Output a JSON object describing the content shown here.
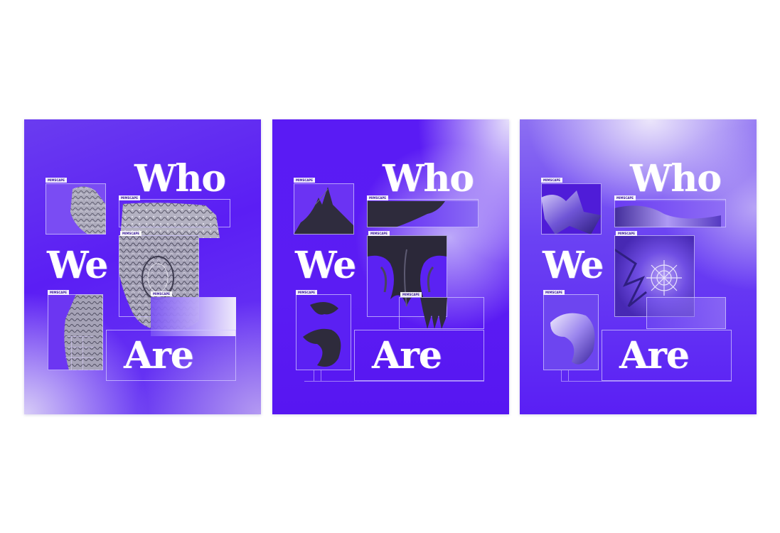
{
  "posters": [
    {
      "words": {
        "line1": "Who",
        "line2": "We",
        "line3": "Are"
      },
      "tags": [
        "MIMSCAPE",
        "MIMSCAPE",
        "MIMSCAPE",
        "MIMSCAPE",
        "MIMSCAPE"
      ]
    },
    {
      "words": {
        "line1": "Who",
        "line2": "We",
        "line3": "Are"
      },
      "tags": [
        "MIMSCAPE",
        "MIMSCAPE",
        "MIMSCAPE",
        "MIMSCAPE",
        "MIMSCAPE"
      ]
    },
    {
      "words": {
        "line1": "Who",
        "line2": "We",
        "line3": "Are"
      },
      "tags": [
        "MIMSCAPE",
        "MIMSCAPE",
        "MIMSCAPE",
        "MIMSCAPE"
      ]
    }
  ],
  "colors": {
    "accent": "#5b1ef4",
    "text": "#ffffff",
    "stone": "#b9b6c6",
    "dark_sculpture": "#2e2b3c",
    "chrome": "#8f7ae6"
  }
}
